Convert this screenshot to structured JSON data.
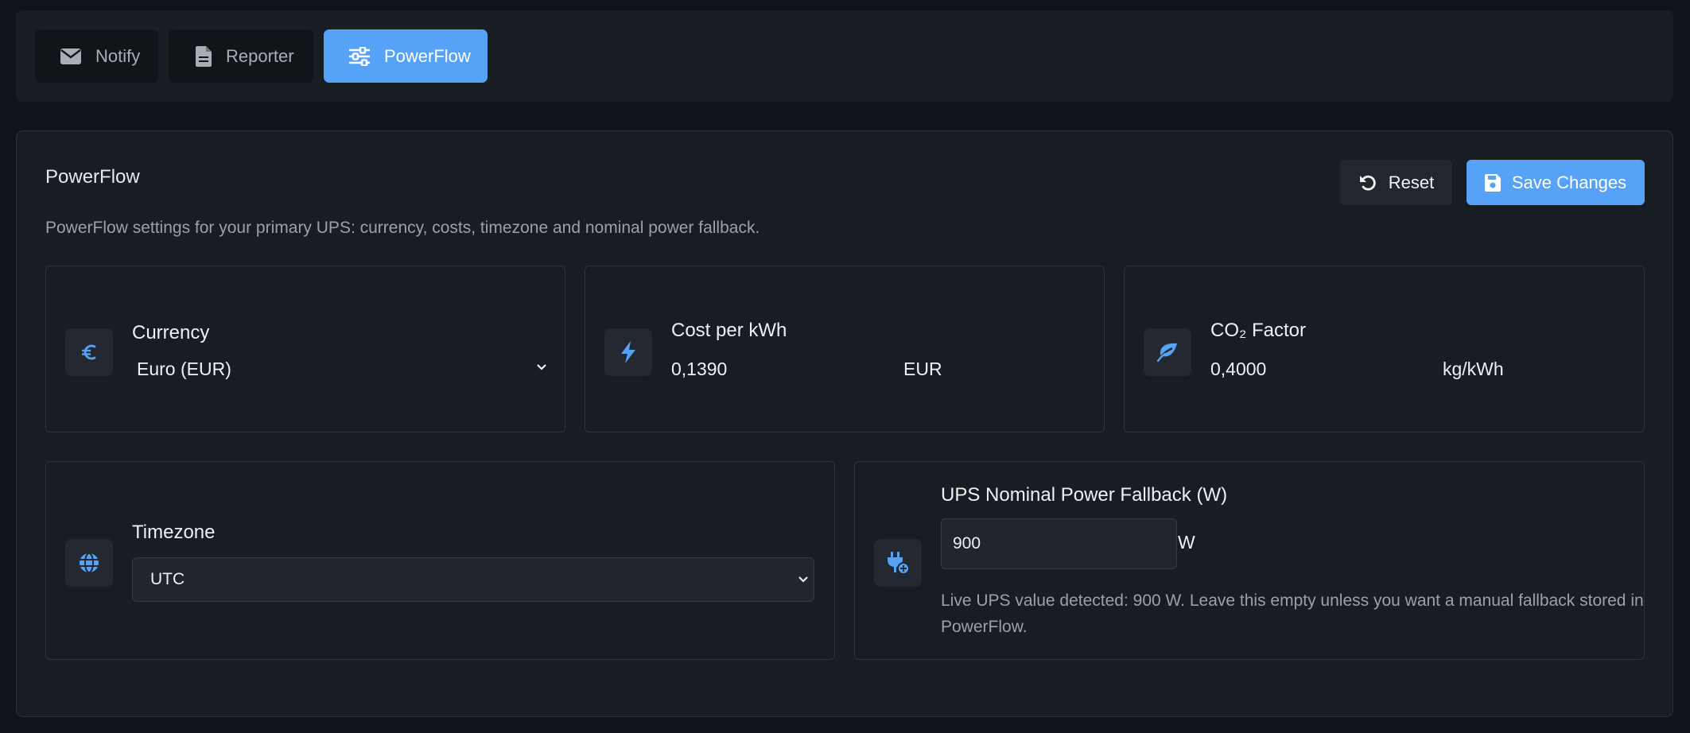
{
  "tabs": [
    {
      "label": "Notify",
      "icon": "envelope-icon"
    },
    {
      "label": "Reporter",
      "icon": "document-icon"
    },
    {
      "label": "PowerFlow",
      "icon": "sliders-icon",
      "active": true
    }
  ],
  "panel": {
    "title": "PowerFlow",
    "description": "PowerFlow settings for your primary UPS: currency, costs, timezone and nominal power fallback.",
    "reset_label": "Reset",
    "save_label": "Save Changes"
  },
  "currency": {
    "label": "Currency",
    "value": "Euro (EUR)",
    "icon": "euro-icon"
  },
  "cost": {
    "label": "Cost per kWh",
    "value": "0,1390",
    "unit": "EUR",
    "icon": "bolt-icon"
  },
  "co2": {
    "label": "CO₂ Factor",
    "value": "0,4000",
    "unit": "kg/kWh",
    "icon": "leaf-icon"
  },
  "timezone": {
    "label": "Timezone",
    "value": "UTC",
    "icon": "globe-icon"
  },
  "ups": {
    "label": "UPS Nominal Power Fallback (W)",
    "value": "900",
    "unit": "W",
    "hint": "Live UPS value detected: 900 W. Leave this empty unless you want a manual fallback stored in PowerFlow.",
    "icon": "plug-icon"
  },
  "colors": {
    "accent": "#55a2f7",
    "background": "#0f131a",
    "panel": "#181c23"
  }
}
